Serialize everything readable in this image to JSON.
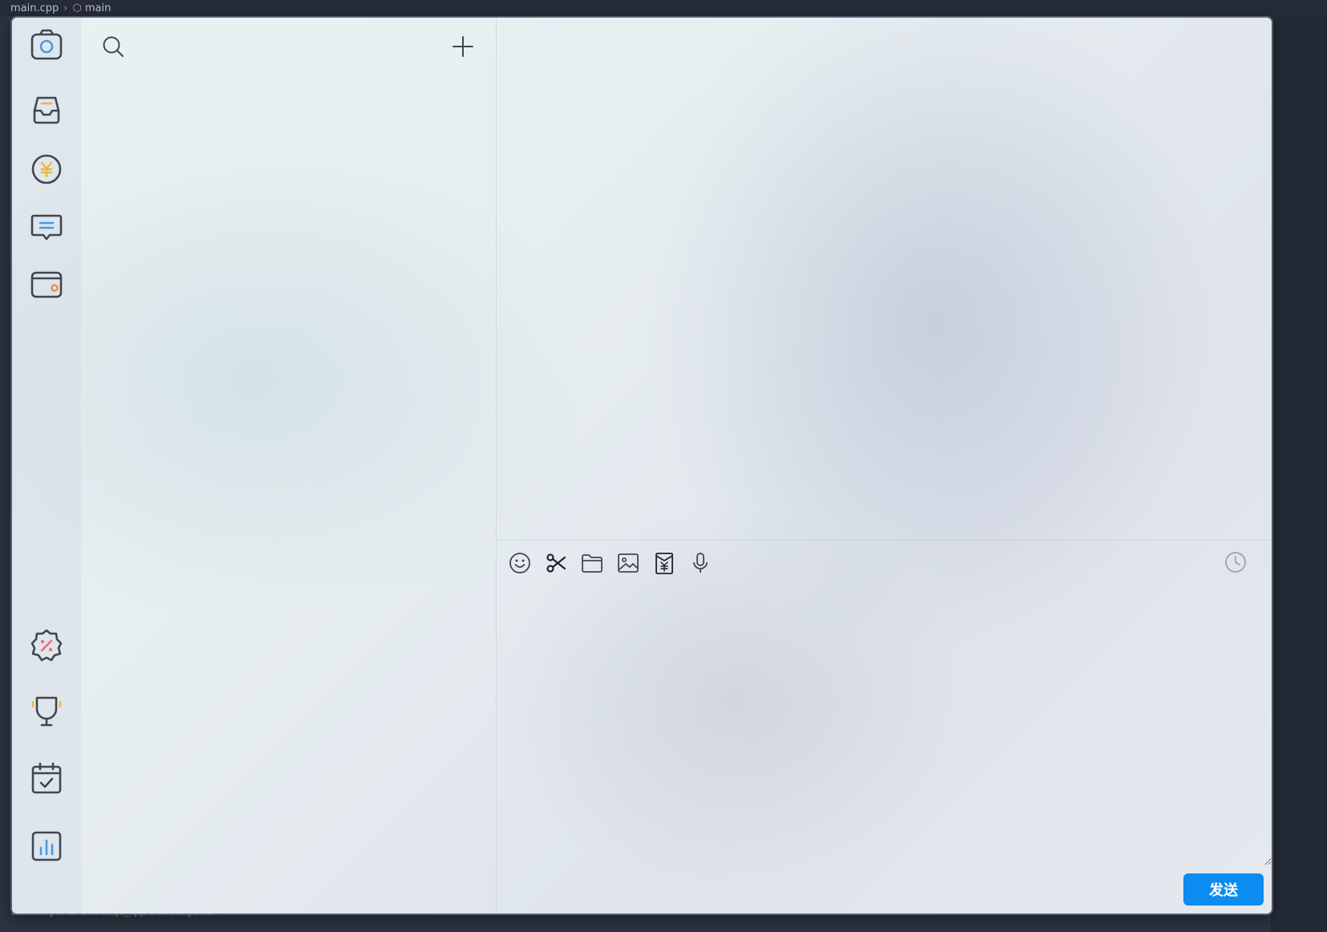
{
  "ide": {
    "breadcrumb_file": "main.cpp",
    "breadcrumb_symbol": "main",
    "terminal_path": "/home/yuri/love/qt_qq/build/yuri"
  },
  "sidebar": {
    "items": [
      {
        "name": "camera",
        "icon": "camera-icon"
      },
      {
        "name": "inbox",
        "icon": "inbox-icon"
      },
      {
        "name": "payment",
        "icon": "yuan-coin-icon"
      },
      {
        "name": "messages",
        "icon": "message-icon"
      },
      {
        "name": "wallet",
        "icon": "wallet-icon"
      },
      {
        "name": "discount",
        "icon": "discount-badge-icon"
      },
      {
        "name": "trophy",
        "icon": "trophy-icon"
      },
      {
        "name": "calendar",
        "icon": "calendar-check-icon"
      },
      {
        "name": "stats",
        "icon": "bar-chart-icon"
      }
    ]
  },
  "list_panel": {
    "search_icon": "search-icon",
    "add_icon": "plus-icon"
  },
  "toolbar": {
    "tools": [
      "emoji-icon",
      "scissors-icon",
      "folder-icon",
      "image-icon",
      "red-packet-icon",
      "microphone-icon"
    ],
    "history_icon": "clock-icon"
  },
  "send": {
    "label": "发送"
  },
  "colors": {
    "send_button": "#0a8cf0",
    "icon_stroke": "#3e4653",
    "accent_yellow": "#f2b640",
    "accent_red": "#ef6b6b",
    "accent_blue": "#4a9ae8"
  }
}
